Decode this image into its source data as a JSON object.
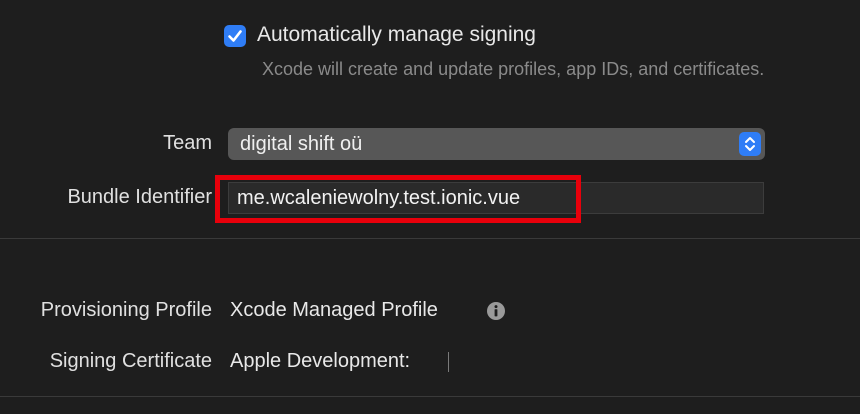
{
  "signing": {
    "auto_manage_label": "Automatically manage signing",
    "auto_manage_checked": true,
    "auto_manage_description": "Xcode will create and update profiles, app IDs, and certificates.",
    "team_label": "Team",
    "team_value": "digital shift oü",
    "bundle_label": "Bundle Identifier",
    "bundle_value": "me.wcaleniewolny.test.ionic.vue",
    "provisioning_label": "Provisioning Profile",
    "provisioning_value": "Xcode Managed Profile",
    "certificate_label": "Signing Certificate",
    "certificate_value": "Apple Development:"
  },
  "icons": {
    "checkbox": "checkmark-icon",
    "popup": "chevron-up-down-icon",
    "info": "info-icon"
  },
  "colors": {
    "background": "#1e1e1e",
    "accent": "#2f7df6",
    "highlight": "#e8000b",
    "secondary_text": "#8a8a8a"
  }
}
